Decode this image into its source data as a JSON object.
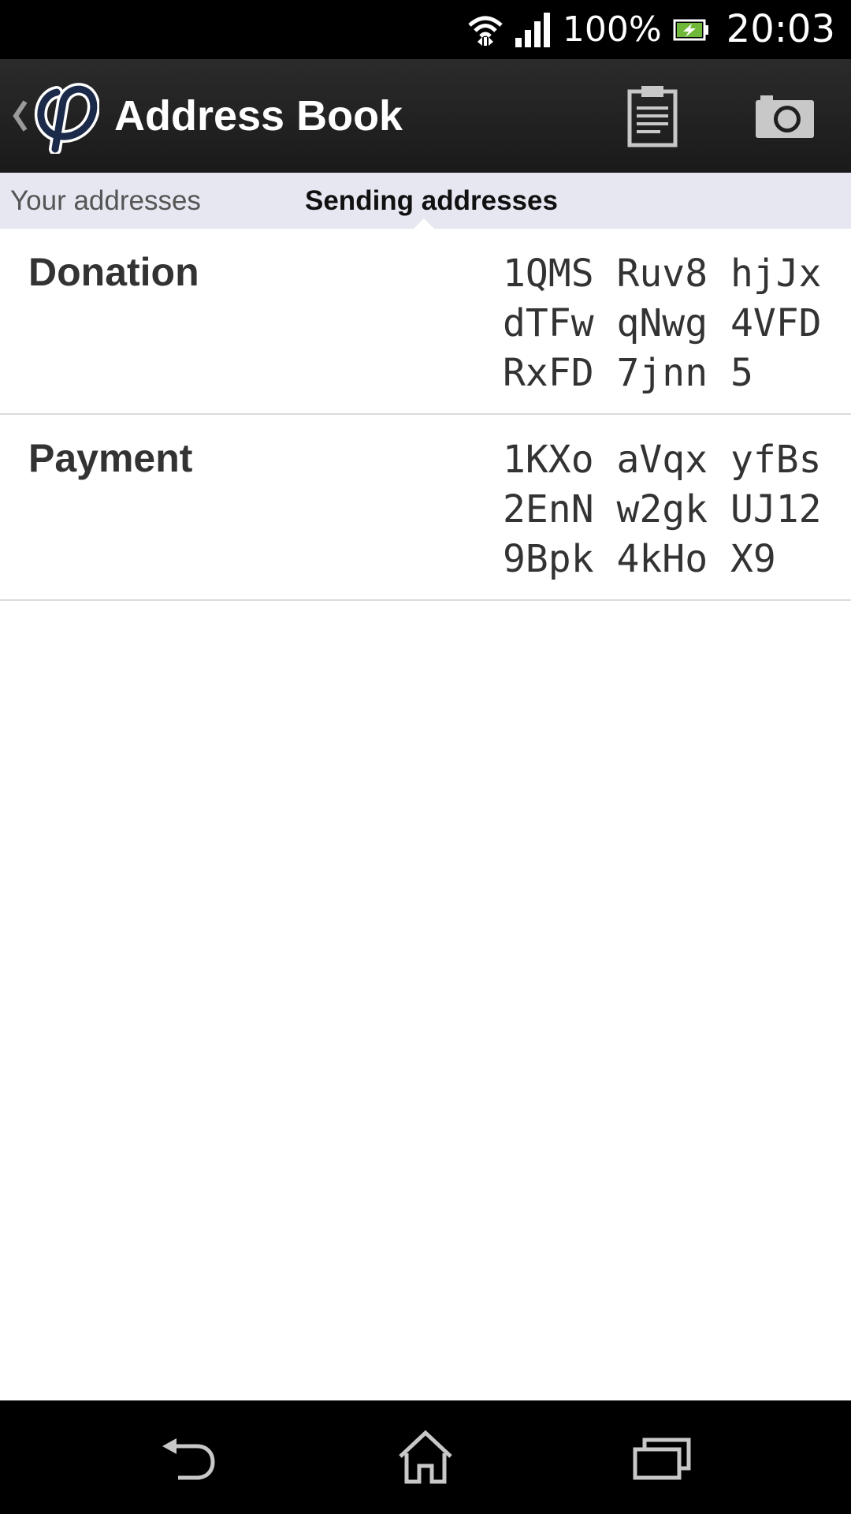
{
  "status_bar": {
    "battery": "100%",
    "time": "20:03"
  },
  "action_bar": {
    "title": "Address Book",
    "icons": {
      "up": "chevron-left-icon",
      "logo": "phi-logo",
      "paste": "clipboard-icon",
      "scan": "camera-icon"
    }
  },
  "tabs": [
    {
      "label": "Your addresses",
      "selected": false
    },
    {
      "label": "Sending addresses",
      "selected": true
    }
  ],
  "addresses": [
    {
      "label": "Donation",
      "address_lines": [
        "1QMS Ruv8 hjJx",
        "dTFw qNwg 4VFD",
        "RxFD 7jnn 5"
      ]
    },
    {
      "label": "Payment",
      "address_lines": [
        "1KXo aVqx yfBs",
        "2EnN w2gk UJ12",
        "9Bpk 4kHo X9"
      ]
    }
  ],
  "nav_bar": {
    "icons": [
      "back-icon",
      "home-icon",
      "recents-icon"
    ]
  },
  "colors": {
    "action_bar": "#1f1f1f",
    "tab_strip": "#e6e7f1",
    "text": "#333333",
    "logo": "#1c2a4a"
  }
}
